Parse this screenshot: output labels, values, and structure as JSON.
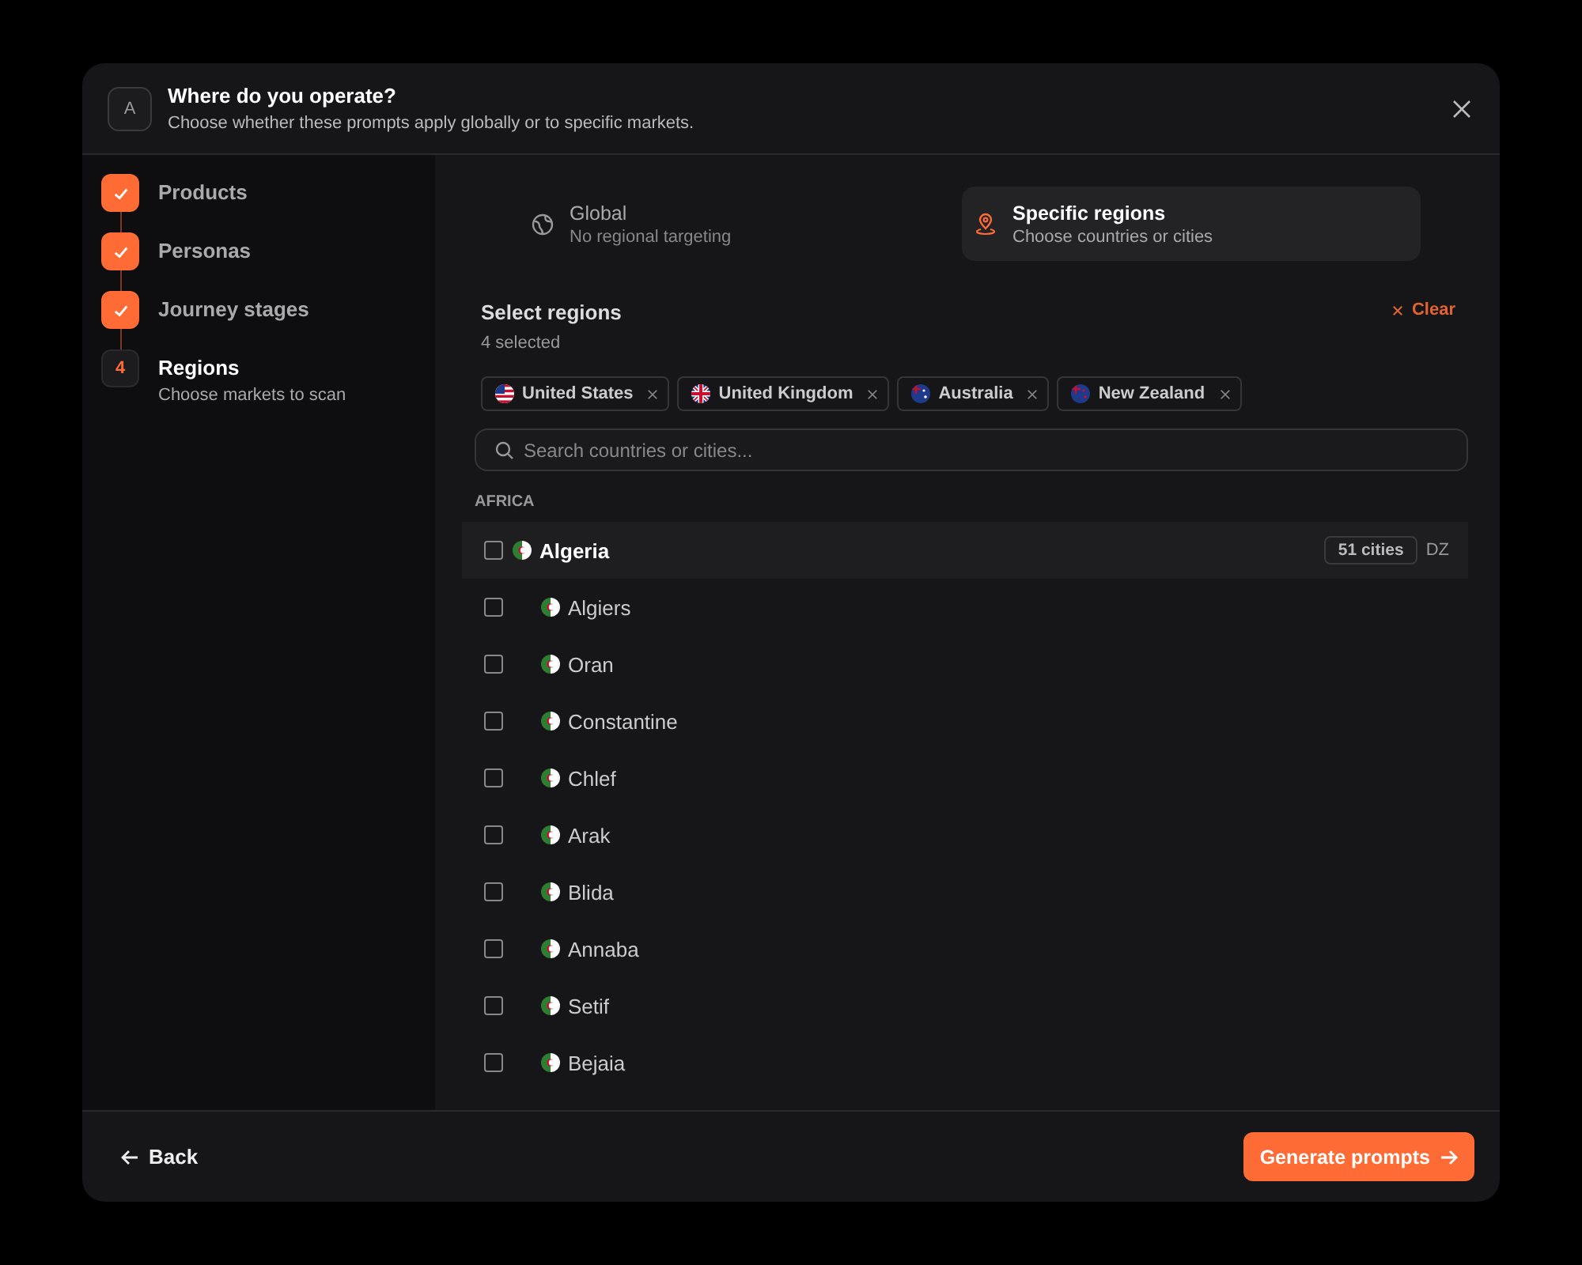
{
  "dialog": {
    "avatar": "A",
    "title": "Where do you operate?",
    "subtitle": "Choose whether these prompts apply globally or to specific markets."
  },
  "steps": [
    {
      "label": "Products",
      "done": true,
      "selected": false
    },
    {
      "label": "Personas",
      "done": true,
      "selected": false
    },
    {
      "label": "Journey stages",
      "done": true,
      "selected": false
    },
    {
      "label": "Regions",
      "done": false,
      "number": "4",
      "selected": true,
      "description": "Choose markets to scan"
    }
  ],
  "scope_options": [
    {
      "kind": "global",
      "title": "Global",
      "description": "No regional targeting",
      "selected": false
    },
    {
      "kind": "regions",
      "title": "Specific regions",
      "description": "Choose countries or cities",
      "selected": true
    }
  ],
  "selection": {
    "title": "Select regions",
    "count": "4 selected",
    "clear": "Clear"
  },
  "chips": [
    {
      "kind": "us",
      "label": "United States"
    },
    {
      "kind": "gb",
      "label": "United Kingdom"
    },
    {
      "kind": "au",
      "label": "Australia"
    },
    {
      "kind": "nz",
      "label": "New Zealand"
    }
  ],
  "search": {
    "placeholder": "Search countries or cities..."
  },
  "groups": [
    {
      "heading": "AFRICA",
      "countries": [
        {
          "name": "Algeria",
          "checked": false,
          "cities_badge": "51 cities",
          "code": "DZ",
          "children": [
            {
              "name": "Algiers",
              "checked": false
            },
            {
              "name": "Oran",
              "checked": false
            },
            {
              "name": "Constantine",
              "checked": false
            },
            {
              "name": "Chlef",
              "checked": false
            },
            {
              "name": "Arak",
              "checked": false
            },
            {
              "name": "Blida",
              "checked": false
            },
            {
              "name": "Annaba",
              "checked": false
            },
            {
              "name": "Setif",
              "checked": false
            },
            {
              "name": "Bejaia",
              "checked": false
            }
          ]
        }
      ]
    }
  ],
  "footer": {
    "back": "Back",
    "primary": "Generate prompts"
  }
}
